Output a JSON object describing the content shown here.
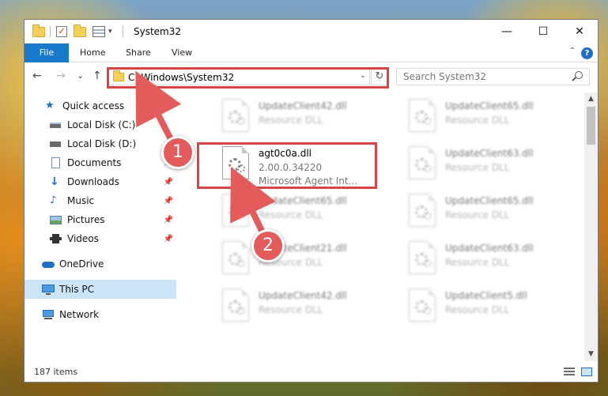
{
  "window": {
    "title": "System32",
    "controls": {
      "minimize": "—",
      "maximize": "☐",
      "close": "✕"
    }
  },
  "ribbon": {
    "tabs": [
      "File",
      "Home",
      "Share",
      "View"
    ],
    "help": "?"
  },
  "nav": {
    "back": "←",
    "forward": "→",
    "recent": "⌄",
    "up": "↑",
    "address": "C:\\Windows\\System32",
    "refresh": "↻",
    "search_placeholder": "Search System32"
  },
  "sidebar": {
    "items": [
      {
        "label": "Quick access",
        "icon": "star-icon",
        "pinned": false
      },
      {
        "label": "Local Disk (C:)",
        "icon": "drive-icon",
        "pinned": false
      },
      {
        "label": "Local Disk (D:)",
        "icon": "drive-icon",
        "pinned": false
      },
      {
        "label": "Documents",
        "icon": "documents-icon",
        "pinned": true
      },
      {
        "label": "Downloads",
        "icon": "download-icon",
        "pinned": true
      },
      {
        "label": "Music",
        "icon": "music-icon",
        "pinned": true
      },
      {
        "label": "Pictures",
        "icon": "pictures-icon",
        "pinned": true
      },
      {
        "label": "Videos",
        "icon": "videos-icon",
        "pinned": true
      },
      {
        "label": "OneDrive",
        "icon": "cloud-icon",
        "pinned": false
      },
      {
        "label": "This PC",
        "icon": "computer-icon",
        "pinned": false,
        "selected": true
      },
      {
        "label": "Network",
        "icon": "network-icon",
        "pinned": false
      }
    ],
    "pin_glyph": "📌"
  },
  "files": [
    {
      "name": "UpdateClient42.dll",
      "type": "Resource DLL",
      "blurred": true
    },
    {
      "name": "UpdateClient65.dll",
      "type": "Resource DLL",
      "blurred": true
    },
    {
      "name": "agt0c0a.dll",
      "version": "2.00.0.34220",
      "type": "Microsoft Agent Int...",
      "blurred": false
    },
    {
      "name": "UpdateClient63.dll",
      "type": "Resource DLL",
      "blurred": true
    },
    {
      "name": "UpdateClient65.dll",
      "type": "Resource DLL",
      "blurred": true
    },
    {
      "name": "UpdateClient65.dll",
      "type": "Resource DLL",
      "blurred": true
    },
    {
      "name": "UpdateClient21.dll",
      "type": "Resource DLL",
      "blurred": true
    },
    {
      "name": "UpdateClient63.dll",
      "type": "Resource DLL",
      "blurred": true
    },
    {
      "name": "UpdateClient42.dll",
      "type": "Resource DLL",
      "blurred": true
    },
    {
      "name": "UpdateClient5.dll",
      "type": "Resource DLL",
      "blurred": true
    }
  ],
  "status": {
    "count": "187 items"
  },
  "annotations": {
    "step1": "1",
    "step2": "2",
    "color": "#e35b5b"
  },
  "colors": {
    "accent": "#1979ca",
    "highlight": "#d64545",
    "selected": "#cce4f7"
  }
}
